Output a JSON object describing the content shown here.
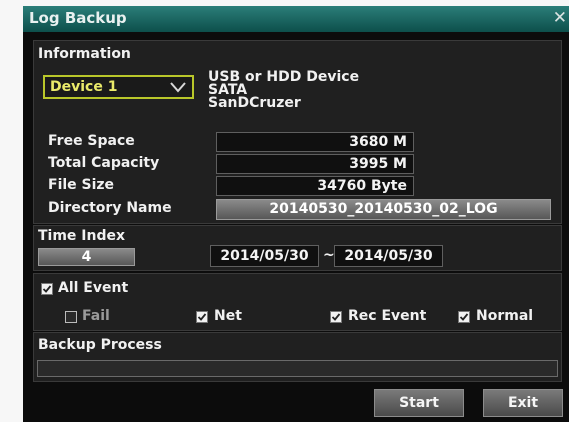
{
  "window": {
    "title": "Log Backup",
    "close_glyph": "✕"
  },
  "information": {
    "heading": "Information",
    "device": {
      "selected": "Device 1"
    },
    "device_info": [
      "USB or HDD Device",
      "SATA",
      "SanDCruzer"
    ],
    "fields": [
      {
        "label": "Free Space",
        "value": "3680 M"
      },
      {
        "label": "Total Capacity",
        "value": "3995 M"
      },
      {
        "label": "File Size",
        "value": "34760 Byte"
      },
      {
        "label": "Directory Name",
        "value": "20140530_20140530_02_LOG"
      }
    ]
  },
  "time_index": {
    "heading": "Time Index",
    "index": "4",
    "start_date": "2014/05/30",
    "separator": "~",
    "end_date": "2014/05/30"
  },
  "events": {
    "all": {
      "label": "All Event",
      "checked": true
    },
    "items": [
      {
        "label": "Fail",
        "checked": false,
        "disabled": true
      },
      {
        "label": "Net",
        "checked": true
      },
      {
        "label": "Rec Event",
        "checked": true
      },
      {
        "label": "Normal",
        "checked": true
      }
    ]
  },
  "backup": {
    "heading": "Backup Process",
    "progress": 0
  },
  "buttons": {
    "start": "Start",
    "exit": "Exit"
  },
  "colors": {
    "title_bar": "#1f6f6a",
    "device_border": "#b9c72a",
    "device_text": "#eaea6a"
  }
}
